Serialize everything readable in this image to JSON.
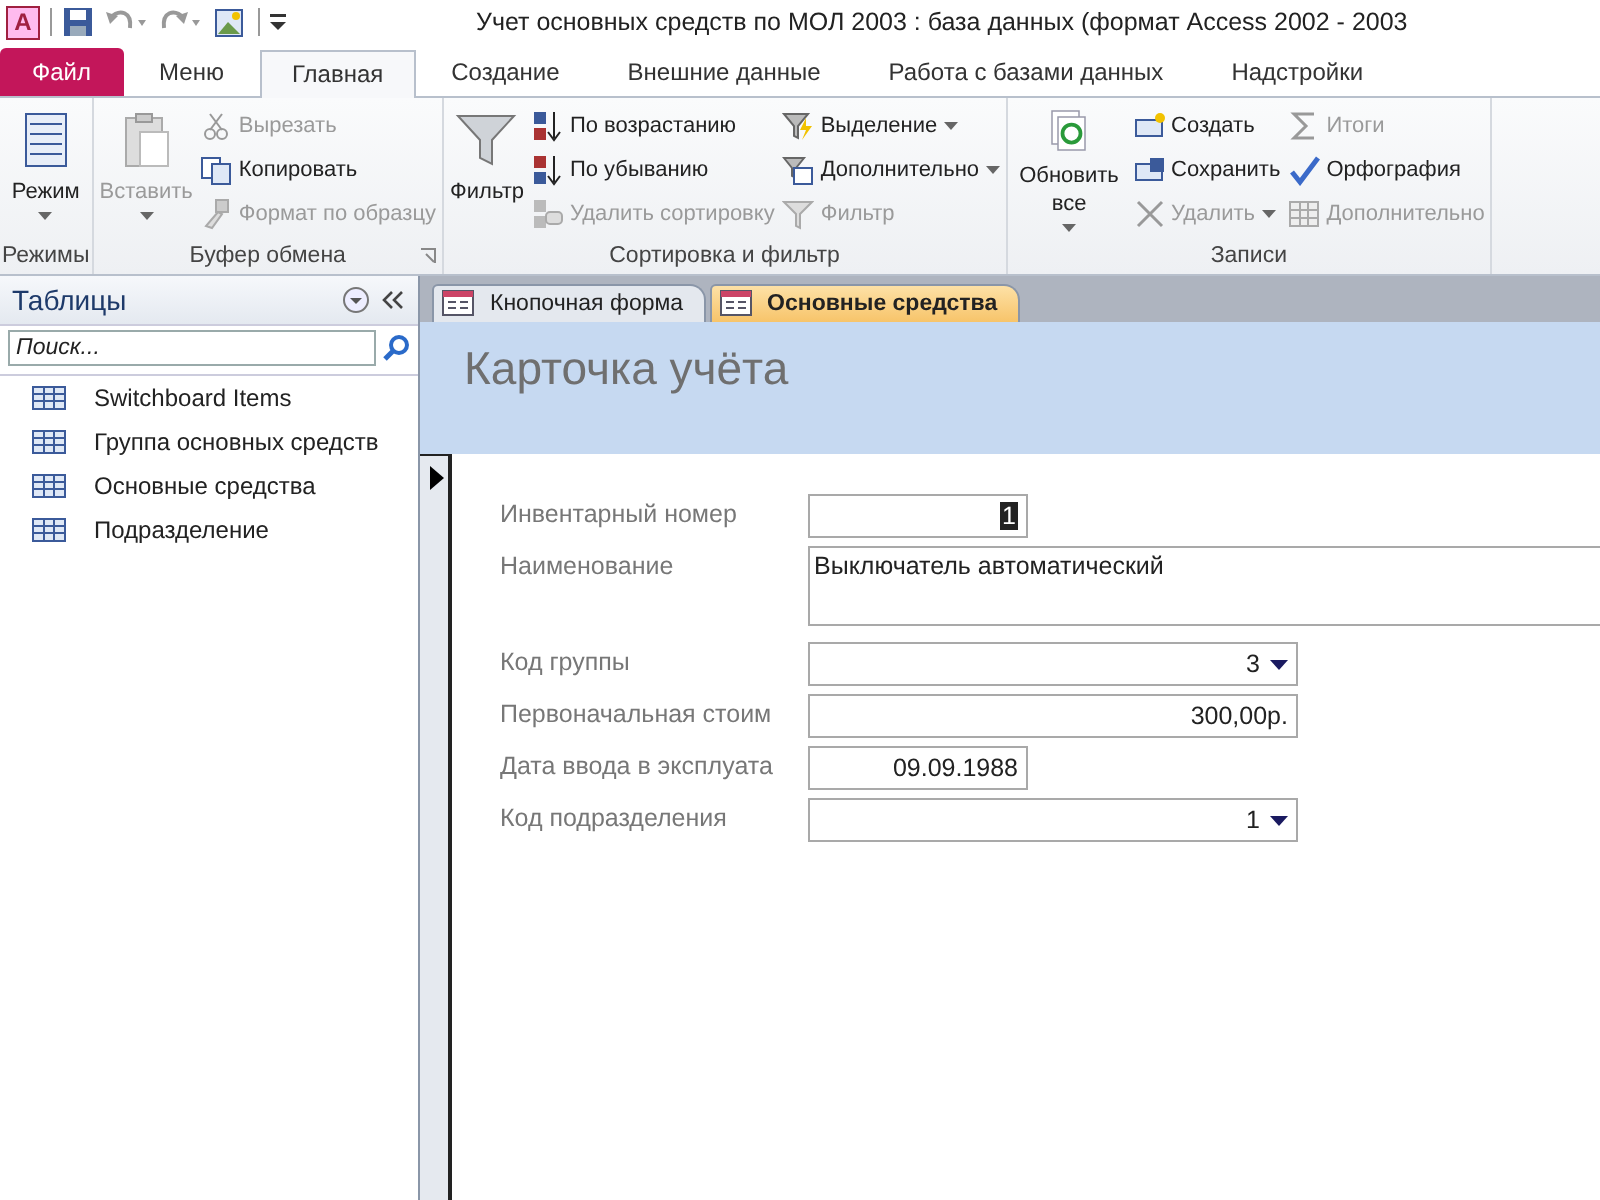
{
  "app_logo": "A",
  "window": {
    "title": "Учет основных средств по МОЛ 2003 : база данных (формат Access 2002 - 2003"
  },
  "ribbon_tabs": [
    {
      "label": "Файл",
      "kind": "file",
      "selected": false
    },
    {
      "label": "Меню",
      "kind": "tab",
      "selected": false
    },
    {
      "label": "Главная",
      "kind": "tab",
      "selected": true
    },
    {
      "label": "Создание",
      "kind": "tab",
      "selected": false
    },
    {
      "label": "Внешние данные",
      "kind": "tab",
      "selected": false
    },
    {
      "label": "Работа с базами данных",
      "kind": "tab",
      "selected": false
    },
    {
      "label": "Надстройки",
      "kind": "tab",
      "selected": false
    }
  ],
  "ribbon_groups": [
    {
      "label": "Режимы",
      "launcher": false,
      "items": [
        {
          "kind": "large",
          "label": "Режим",
          "dropdown": true,
          "disabled": false
        }
      ]
    },
    {
      "label": "Буфер обмена",
      "launcher": true,
      "items": [
        {
          "kind": "large",
          "label": "Вставить",
          "dropdown": true,
          "disabled": true
        },
        {
          "kind": "small",
          "label": "Вырезать",
          "dropdown": false,
          "disabled": true
        },
        {
          "kind": "small",
          "label": "Копировать",
          "dropdown": false,
          "disabled": false
        },
        {
          "kind": "small",
          "label": "Формат по образцу",
          "dropdown": false,
          "disabled": true
        }
      ]
    },
    {
      "label": "Сортировка и фильтр",
      "launcher": false,
      "items": [
        {
          "kind": "large",
          "label": "Фильтр",
          "dropdown": false,
          "disabled": false
        },
        {
          "kind": "small",
          "label": "По возрастанию",
          "dropdown": false,
          "disabled": false
        },
        {
          "kind": "small",
          "label": "По убыванию",
          "dropdown": false,
          "disabled": false
        },
        {
          "kind": "small",
          "label": "Удалить сортировку",
          "dropdown": false,
          "disabled": true
        },
        {
          "kind": "small",
          "label": "Выделение",
          "dropdown": true,
          "disabled": false
        },
        {
          "kind": "small",
          "label": "Дополнительно",
          "dropdown": true,
          "disabled": false
        },
        {
          "kind": "small",
          "label": "Фильтр",
          "dropdown": false,
          "disabled": true
        }
      ]
    },
    {
      "label": "Записи",
      "launcher": false,
      "items": [
        {
          "kind": "large",
          "label": "Обновить все",
          "dropdown": true,
          "disabled": false
        },
        {
          "kind": "small",
          "label": "Создать",
          "dropdown": false,
          "disabled": false
        },
        {
          "kind": "small",
          "label": "Сохранить",
          "dropdown": false,
          "disabled": false
        },
        {
          "kind": "small",
          "label": "Удалить",
          "dropdown": true,
          "disabled": true
        },
        {
          "kind": "small",
          "label": "Итоги",
          "dropdown": false,
          "disabled": true
        },
        {
          "kind": "small",
          "label": "Орфография",
          "dropdown": false,
          "disabled": false
        },
        {
          "kind": "small",
          "label": "Дополнительно",
          "dropdown": false,
          "disabled": true
        }
      ]
    }
  ],
  "nav_pane": {
    "title": "Таблицы",
    "search": {
      "placeholder": "Поиск..."
    },
    "items": [
      {
        "label": "Switchboard Items"
      },
      {
        "label": "Группа основных средств"
      },
      {
        "label": "Основные средства"
      },
      {
        "label": "Подразделение"
      }
    ]
  },
  "document_tabs": [
    {
      "label": "Кнопочная форма",
      "selected": false
    },
    {
      "label": "Основные средства",
      "selected": true
    }
  ],
  "form": {
    "title": "Карточка учёта",
    "fields": [
      {
        "label": "Инвентарный номер",
        "value": "1",
        "kind": "number",
        "selected": true
      },
      {
        "label": "Наименование",
        "value": "Выключатель автоматический",
        "kind": "memo",
        "selected": false
      },
      {
        "label": "Код группы",
        "value": "3",
        "kind": "combo",
        "selected": false
      },
      {
        "label": "Первоначальная стоим",
        "value": "300,00р.",
        "kind": "currency",
        "selected": false
      },
      {
        "label": "Дата ввода в эксплуата",
        "value": "09.09.1988",
        "kind": "date",
        "selected": false
      },
      {
        "label": "Код подразделения",
        "value": "1",
        "kind": "combo",
        "selected": false
      }
    ]
  }
}
